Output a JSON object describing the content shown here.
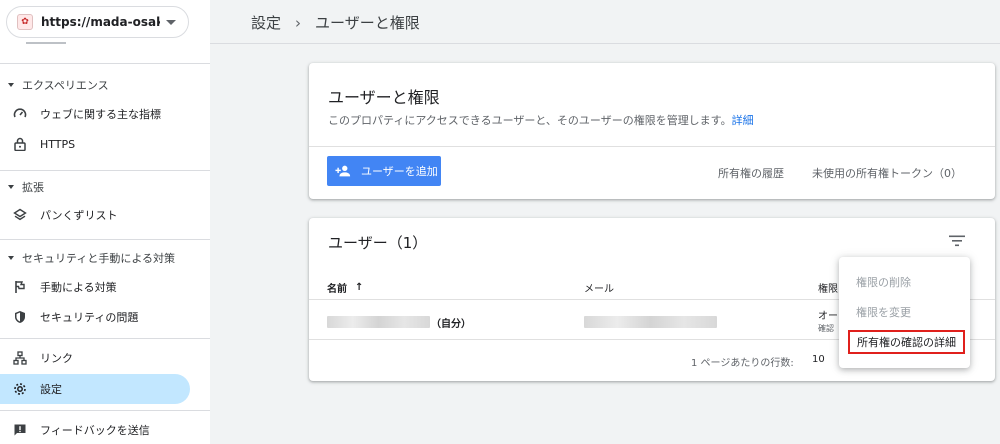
{
  "property": {
    "url": "https://mada-osaka.blo..."
  },
  "sidebar": {
    "sections": [
      {
        "label": "エクスペリエンス",
        "items": [
          {
            "label": "ウェブに関する主な指標"
          },
          {
            "label": "HTTPS"
          }
        ]
      },
      {
        "label": "拡張",
        "items": [
          {
            "label": "パンくずリスト"
          }
        ]
      },
      {
        "label": "セキュリティと手動による対策",
        "items": [
          {
            "label": "手動による対策"
          },
          {
            "label": "セキュリティの問題"
          }
        ]
      }
    ],
    "bottom": [
      {
        "label": "リンク"
      },
      {
        "label": "設定",
        "active": true
      }
    ],
    "feedback": "フィードバックを送信"
  },
  "breadcrumb": {
    "root": "設定",
    "sep": "›",
    "current": "ユーザーと権限"
  },
  "card1": {
    "title": "ユーザーと権限",
    "description": "このプロパティにアクセスできるユーザーと、そのユーザーの権限を管理します。",
    "details_link": "詳細",
    "add_user": "ユーザーを追加",
    "ownership_history": "所有権の履歴",
    "unused_tokens": "未使用の所有権トークン（0）"
  },
  "users": {
    "title": "ユーザー（1）",
    "columns": {
      "name": "名前",
      "sort_arrow": "↑",
      "email": "メール",
      "permission": "権限"
    },
    "row": {
      "name_suffix": "（自分）",
      "permission": "オー",
      "permission_sub": "確認"
    },
    "pager": {
      "label": "1 ページあたりの行数:",
      "value": "10"
    }
  },
  "menu": {
    "items": [
      {
        "label": "権限の削除",
        "disabled": true
      },
      {
        "label": "権限を変更",
        "disabled": true
      },
      {
        "label": "所有権の確認の詳細",
        "highlighted": true
      }
    ]
  },
  "icons": {
    "favicon": "site-favicon",
    "speed": "gauge-icon",
    "lock": "lock-icon",
    "layers": "layers-icon",
    "flag": "flag-icon",
    "shield": "shield-icon",
    "sitemap": "link-tree-icon",
    "gear": "gear-icon",
    "feedback": "feedback-icon",
    "add_person": "add-person-icon",
    "filter": "filter-icon"
  },
  "colors": {
    "accent": "#4285f4",
    "link": "#1a73e8",
    "active_nav": "#c2e7ff",
    "highlight_border": "#e0201c"
  }
}
